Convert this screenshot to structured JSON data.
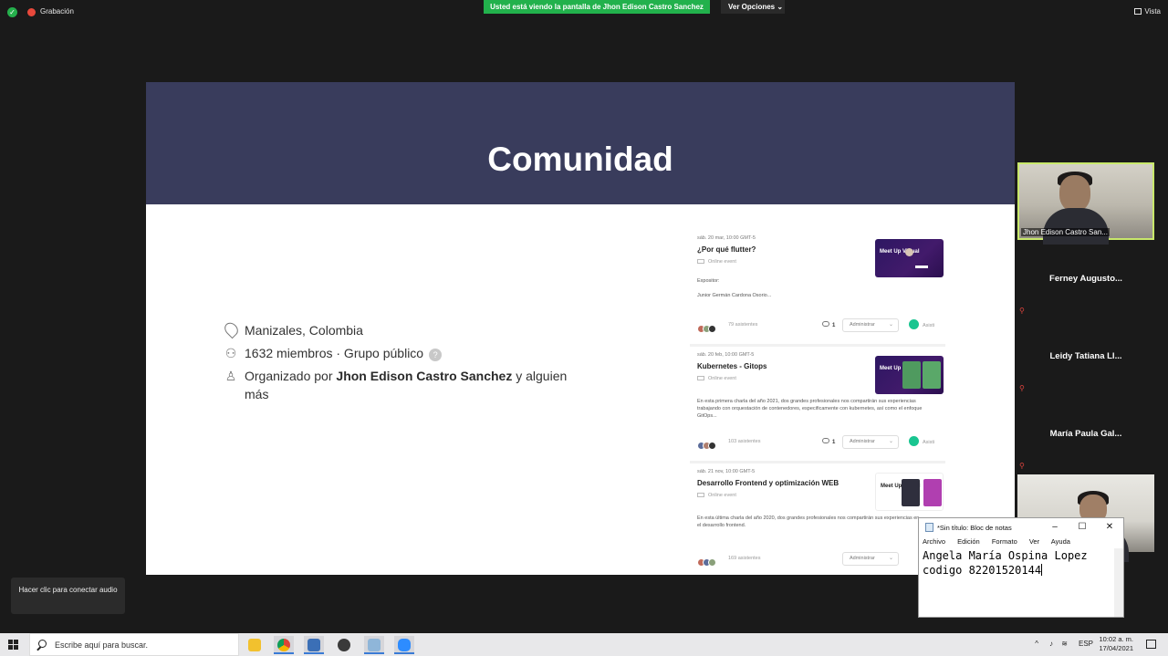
{
  "zoom": {
    "recording_label": "Grabación",
    "share_banner": "Usted está viendo la pantalla de Jhon Edison Castro Sanchez",
    "view_options": "Ver Opciones",
    "view_label": "Vista"
  },
  "slide": {
    "title": "Comunidad",
    "group": {
      "location": "Manizales, Colombia",
      "members": "1632 miembros · Grupo público",
      "help": "?",
      "organized_prefix": "Organizado por",
      "organizer": "Jhon Edison Castro Sanchez",
      "organized_suffix": "y alguien más"
    },
    "events": [
      {
        "date": "sáb. 20 mar, 10:00 GMT-5",
        "title": "¿Por qué flutter?",
        "online": "Online event",
        "desc_1": "Expositor:",
        "desc_2": "Junior Germán Cardona Osorio...",
        "attendees": "79 asistentes",
        "comments": "1",
        "admin": "Administrar",
        "attend": "Asisti",
        "thumb_text": "Meet Up Virtual"
      },
      {
        "date": "sáb. 20 feb, 10:00 GMT-5",
        "title": "Kubernetes - Gitops",
        "online": "Online event",
        "desc_1": "En esta primera charla del año 2021, dos grandes profesionales nos compartirán sus experiencias trabajando con orquestación de contenedores, especificamente con kubernetes, así como el enfoque GitOps...",
        "desc_2": "",
        "attendees": "103 asistentes",
        "comments": "1",
        "admin": "Administrar",
        "attend": "Asisti",
        "thumb_text": "Meet Up Virtual"
      },
      {
        "date": "sáb. 21 nov, 10:00 GMT-5",
        "title": "Desarrollo Frontend y optimización WEB",
        "online": "Online event",
        "desc_1": "En esta última charla del año 2020, dos grandes profesionales nos compartirán sus experiencias en el desarrollo frontend.",
        "desc_2": "",
        "attendees": "169 asistentes",
        "comments": "",
        "admin": "Administrar",
        "attend": "",
        "thumb_text": "Meet Up Virtual"
      }
    ]
  },
  "participants": {
    "active_name": "Jhon Edison Castro San...",
    "others": [
      "Ferney Augusto...",
      "Leidy Tatiana Ll...",
      "María Paula Gal..."
    ]
  },
  "notepad": {
    "title": "*Sin título: Bloc de notas",
    "menu": [
      "Archivo",
      "Edición",
      "Formato",
      "Ver",
      "Ayuda"
    ],
    "line_1": "Angela María Ospina Lopez",
    "line_2": "codigo 82201520144"
  },
  "audio_tip": "Hacer clic para conectar audio",
  "taskbar": {
    "search_placeholder": "Escribe aquí para buscar.",
    "lang": "ESP",
    "time": "10:02 a. m.",
    "date": "17/04/2021"
  }
}
